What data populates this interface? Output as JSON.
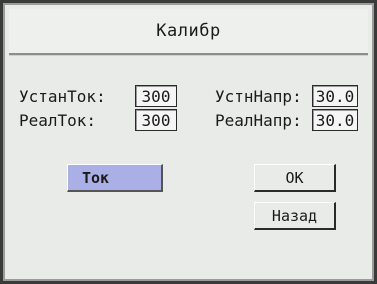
{
  "window": {
    "title": "Калибр"
  },
  "fields": {
    "set_current_label": "УстанТок:",
    "set_current_value": "300",
    "real_current_label": "РеалТок:",
    "real_current_value": "300",
    "set_voltage_label": "УстнНапр:",
    "set_voltage_value": "30.0",
    "real_voltage_label": "РеалНапр:",
    "real_voltage_value": "30.0"
  },
  "buttons": {
    "mode_label": "Ток",
    "ok_label": "ОК",
    "back_label": "Назад"
  },
  "colors": {
    "selected_button": "#aab0e6",
    "screen_background": "#e9ebe9"
  }
}
